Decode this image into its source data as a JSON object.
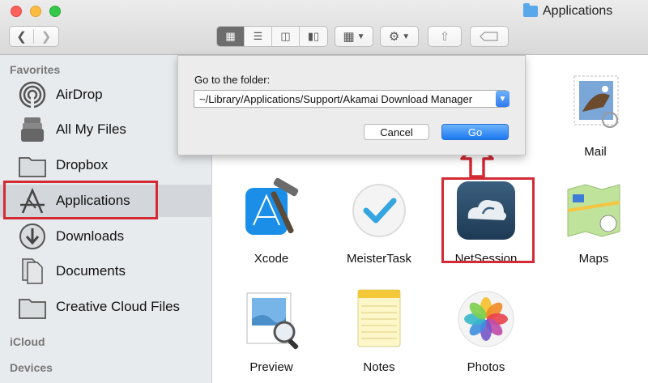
{
  "window": {
    "title": "Applications"
  },
  "toolbar": {
    "back_icon": "chevron-left-icon",
    "forward_icon": "chevron-right-icon",
    "view_modes": [
      "icon-view-icon",
      "list-view-icon",
      "column-view-icon",
      "cover-flow-icon"
    ],
    "arrange_icon": "arrange-icon",
    "action_icon": "gear-icon",
    "share_icon": "share-icon",
    "tags_icon": "tag-icon"
  },
  "sidebar": {
    "favorites_heading": "Favorites",
    "items": [
      {
        "label": "AirDrop",
        "icon": "airdrop-icon"
      },
      {
        "label": "All My Files",
        "icon": "all-files-icon"
      },
      {
        "label": "Dropbox",
        "icon": "folder-icon"
      },
      {
        "label": "Applications",
        "icon": "applications-icon",
        "selected": true
      },
      {
        "label": "Downloads",
        "icon": "download-icon"
      },
      {
        "label": "Documents",
        "icon": "documents-icon"
      },
      {
        "label": "Creative Cloud Files",
        "icon": "folder-icon"
      }
    ],
    "icloud_heading": "iCloud",
    "devices_heading": "Devices"
  },
  "dialog": {
    "label": "Go to the folder:",
    "path_value": "~/Library/Applications/Support/Akamai Download Manager",
    "cancel_label": "Cancel",
    "go_label": "Go"
  },
  "apps": [
    {
      "label": "Mail",
      "icon": "mail-icon"
    },
    {
      "label": "Xcode",
      "icon": "xcode-icon"
    },
    {
      "label": "MeisterTask",
      "icon": "meistertask-icon"
    },
    {
      "label": "NetSession",
      "icon": "netsession-icon"
    },
    {
      "label": "Maps",
      "icon": "maps-icon"
    },
    {
      "label": "Preview",
      "icon": "preview-icon"
    },
    {
      "label": "Notes",
      "icon": "notes-icon"
    },
    {
      "label": "Photos",
      "icon": "photos-icon"
    }
  ],
  "colors": {
    "highlight": "#d32a34",
    "accent": "#2e7cf0",
    "sidebar_bg": "#e8ebee"
  }
}
